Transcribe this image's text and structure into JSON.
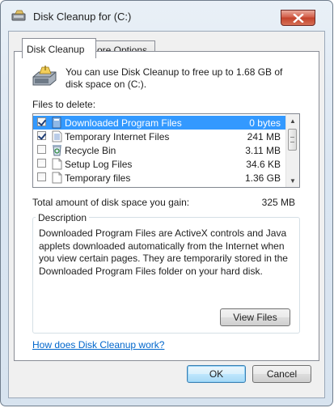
{
  "window": {
    "title": "Disk Cleanup for  (C:)",
    "close_symbol": "x"
  },
  "tabs": [
    {
      "label": "Disk Cleanup",
      "active": true
    },
    {
      "label": "More Options",
      "active": false
    }
  ],
  "info": {
    "text": "You can use Disk Cleanup to free up to 1.68 GB of disk space on  (C:).",
    "icon": "drive-cleanup-icon"
  },
  "files": {
    "label": "Files to delete:",
    "items": [
      {
        "name": "Downloaded Program Files",
        "size": "0 bytes",
        "checked": true,
        "selected": true,
        "icon": "folder-icon"
      },
      {
        "name": "Temporary Internet Files",
        "size": "241 MB",
        "checked": true,
        "selected": false,
        "icon": "document-icon"
      },
      {
        "name": "Recycle Bin",
        "size": "3.11 MB",
        "checked": false,
        "selected": false,
        "icon": "recycle-bin-icon"
      },
      {
        "name": "Setup Log Files",
        "size": "34.6 KB",
        "checked": false,
        "selected": false,
        "icon": "document-icon"
      },
      {
        "name": "Temporary files",
        "size": "1.36 GB",
        "checked": false,
        "selected": false,
        "icon": "document-icon"
      }
    ]
  },
  "total": {
    "label": "Total amount of disk space you gain:",
    "value": "325 MB"
  },
  "description": {
    "legend": "Description",
    "text": "Downloaded Program Files are ActiveX controls and Java applets downloaded automatically from the Internet when you view certain pages. They are temporarily stored in the Downloaded Program Files folder on your hard disk.",
    "view_files_label": "View Files"
  },
  "help_link": "How does Disk Cleanup work?",
  "footer": {
    "ok_label": "OK",
    "cancel_label": "Cancel"
  },
  "colors": {
    "selection": "#3399ff",
    "link": "#0066cc",
    "close_button": "#c3422b"
  }
}
